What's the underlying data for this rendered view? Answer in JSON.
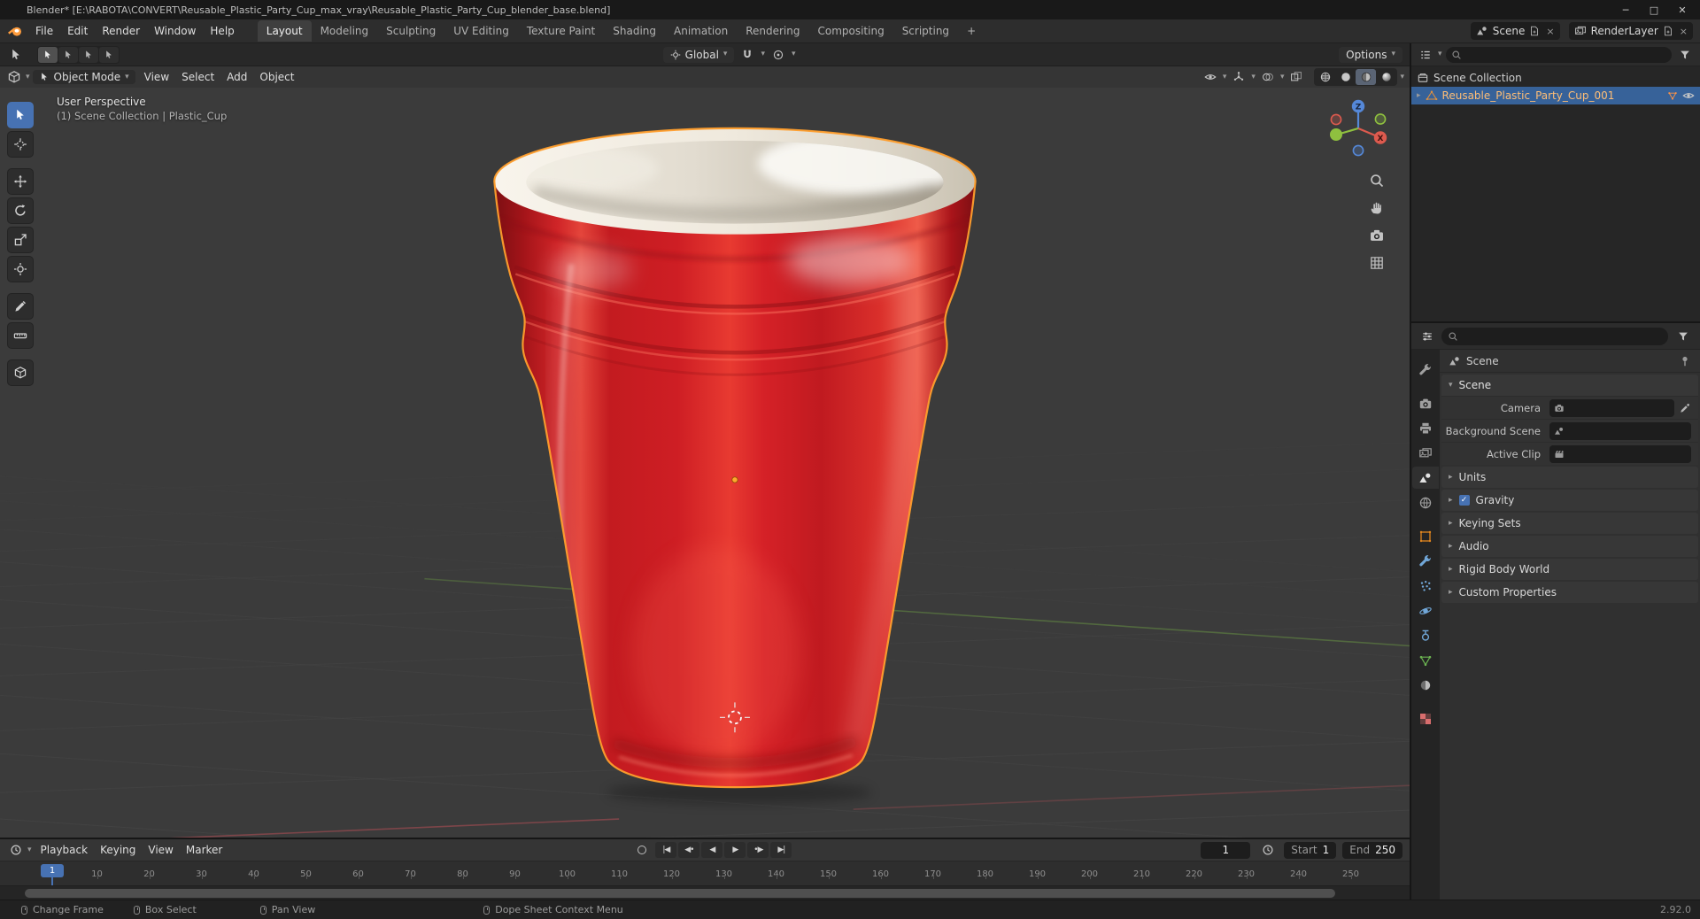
{
  "icons": {
    "chevron_down": "▾",
    "disclosure_right": "▸",
    "panel_open": "▾",
    "x_small": "×"
  },
  "titlebar": {
    "title": "Blender* [E:\\RABOTA\\CONVERT\\Reusable_Plastic_Party_Cup_max_vray\\Reusable_Plastic_Party_Cup_blender_base.blend]",
    "minimize": "─",
    "maximize": "□",
    "close": "✕"
  },
  "menubar": {
    "menus": [
      "File",
      "Edit",
      "Render",
      "Window",
      "Help"
    ],
    "workspaces": [
      {
        "label": "Layout",
        "active": true
      },
      {
        "label": "Modeling"
      },
      {
        "label": "Sculpting"
      },
      {
        "label": "UV Editing"
      },
      {
        "label": "Texture Paint"
      },
      {
        "label": "Shading"
      },
      {
        "label": "Animation"
      },
      {
        "label": "Rendering"
      },
      {
        "label": "Compositing"
      },
      {
        "label": "Scripting"
      }
    ],
    "new_workspace_label": "+",
    "scene_value": "Scene",
    "view_layer_value": "RenderLayer"
  },
  "tool_settings": {
    "orientation_value": "Global",
    "options_label": "Options"
  },
  "viewport": {
    "mode_value": "Object Mode",
    "menus": [
      "View",
      "Select",
      "Add",
      "Object"
    ],
    "overlay_line1": "User Perspective",
    "overlay_line2": "(1) Scene Collection | Plastic_Cup",
    "gizmo": {
      "x_label": "X",
      "z_label": "Z"
    },
    "tools": [
      {
        "name": "select-box",
        "icon": "cursor",
        "active": true
      },
      {
        "name": "cursor-3d",
        "icon": "cursor3d"
      },
      {
        "name": "move",
        "icon": "move"
      },
      {
        "name": "rotate",
        "icon": "rotate"
      },
      {
        "name": "scale",
        "icon": "scale"
      },
      {
        "name": "transform",
        "icon": "transform"
      },
      {
        "name": "annotate",
        "icon": "pen"
      },
      {
        "name": "measure",
        "icon": "ruler"
      },
      {
        "name": "add-cube",
        "icon": "cube"
      }
    ]
  },
  "outliner": {
    "root_label": "Scene Collection",
    "object_label": "Reusable_Plastic_Party_Cup_001"
  },
  "properties": {
    "breadcrumb": "Scene",
    "tabs": [
      {
        "name": "tool",
        "icon": "tool"
      },
      {
        "name": "render",
        "icon": "camera"
      },
      {
        "name": "output",
        "icon": "printer"
      },
      {
        "name": "view-layer",
        "icon": "images"
      },
      {
        "name": "scene",
        "icon": "scene",
        "active": true
      },
      {
        "name": "world",
        "icon": "world"
      },
      {
        "name": "object",
        "icon": "objsquare"
      },
      {
        "name": "modifiers",
        "icon": "tool"
      },
      {
        "name": "particles",
        "icon": "particles"
      },
      {
        "name": "physics",
        "icon": "physics"
      },
      {
        "name": "constraints",
        "icon": "constraint"
      },
      {
        "name": "data",
        "icon": "data"
      },
      {
        "name": "material",
        "icon": "matsphere"
      },
      {
        "name": "texture",
        "icon": "checker"
      }
    ],
    "scene_panel_title": "Scene",
    "scene_fields": [
      {
        "label": "Camera",
        "icon": "camera",
        "dropper": true
      },
      {
        "label": "Background Scene",
        "icon": "scene"
      },
      {
        "label": "Active Clip",
        "icon": "clapper"
      }
    ],
    "collapsed_panels": [
      {
        "label": "Units"
      },
      {
        "label": "Gravity",
        "checkbox": true
      },
      {
        "label": "Keying Sets"
      },
      {
        "label": "Audio"
      },
      {
        "label": "Rigid Body World"
      },
      {
        "label": "Custom Properties"
      }
    ]
  },
  "timeline": {
    "menus": [
      "Playback",
      "Keying",
      "View",
      "Marker"
    ],
    "playback": [
      {
        "name": "jump-start",
        "glyph": "|◀"
      },
      {
        "name": "prev-keyframe",
        "glyph": "◀•"
      },
      {
        "name": "play-reverse",
        "glyph": "◀"
      },
      {
        "name": "play",
        "glyph": "▶"
      },
      {
        "name": "next-keyframe",
        "glyph": "•▶"
      },
      {
        "name": "jump-end",
        "glyph": "▶|"
      }
    ],
    "current_frame": "1",
    "frame_value": "1",
    "start_label": "Start",
    "start_value": "1",
    "end_label": "End",
    "end_value": "250",
    "ticks": [
      "10",
      "20",
      "30",
      "40",
      "50",
      "60",
      "70",
      "80",
      "90",
      "100",
      "110",
      "120",
      "130",
      "140",
      "150",
      "160",
      "170",
      "180",
      "190",
      "200",
      "210",
      "220",
      "230",
      "240",
      "250"
    ]
  },
  "statusbar": {
    "hints": [
      {
        "label": "Change Frame"
      },
      {
        "label": "Box Select"
      },
      {
        "label": "Pan View"
      },
      {
        "label": "Dope Sheet Context Menu"
      }
    ],
    "version": "2.92.0"
  }
}
